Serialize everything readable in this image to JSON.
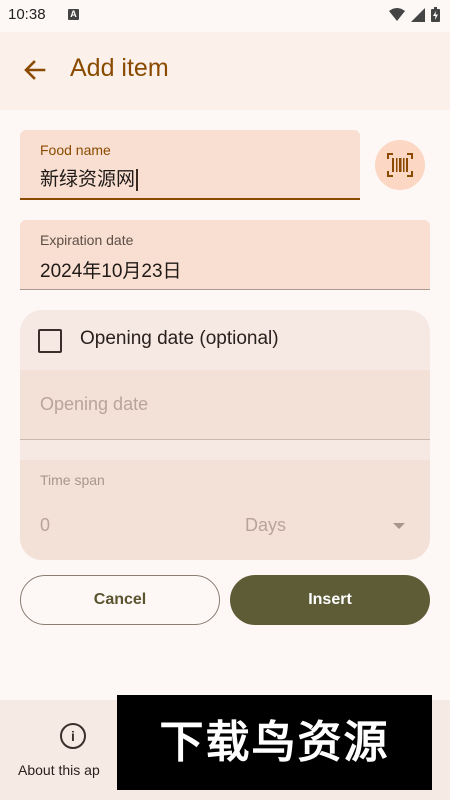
{
  "status_bar": {
    "time": "10:38",
    "notification_glyph": "A"
  },
  "app_bar": {
    "title": "Add item"
  },
  "form": {
    "food_name": {
      "label": "Food name",
      "value": "新绿资源网"
    },
    "expiration_date": {
      "label": "Expiration date",
      "value": "2024年10月23日"
    },
    "opening": {
      "checkbox_label": "Opening date (optional)",
      "checked": false,
      "opening_date_placeholder": "Opening date",
      "time_span_label": "Time span",
      "time_span_value": "0",
      "time_span_unit": "Days"
    }
  },
  "buttons": {
    "cancel": "Cancel",
    "insert": "Insert"
  },
  "bottom_nav": {
    "about_label": "About this ap"
  },
  "watermark": {
    "text": "下载鸟资源"
  },
  "colors": {
    "accent": "#8a4b00",
    "insert_button": "#5e5c36",
    "field_bg": "#f8dfd1"
  }
}
